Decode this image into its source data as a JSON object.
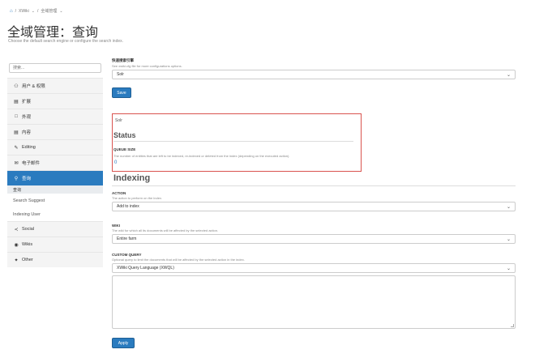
{
  "breadcrumb": {
    "home_icon": "home-icon",
    "items": [
      "XWiki",
      "全域管理"
    ]
  },
  "page": {
    "title": "全域管理：查询",
    "description": "Choose the default search engine or configure the search index."
  },
  "sidebar": {
    "search_placeholder": "搜索...",
    "items": [
      {
        "label": "用户 & 权限",
        "icon": "users-icon"
      },
      {
        "label": "扩展",
        "icon": "extension-icon"
      },
      {
        "label": "外观",
        "icon": "layout-icon"
      },
      {
        "label": "内容",
        "icon": "document-icon"
      },
      {
        "label": "Editing",
        "icon": "pencil-icon"
      },
      {
        "label": "电子邮件",
        "icon": "mail-icon"
      },
      {
        "label": "查询",
        "icon": "search-icon"
      }
    ],
    "active_sub": "查询",
    "sub_links": [
      "Search Suggest",
      "Indexing User"
    ],
    "bottom_items": [
      {
        "label": "Social",
        "icon": "share-icon"
      },
      {
        "label": "Wikis",
        "icon": "globe-icon"
      },
      {
        "label": "Other",
        "icon": "wrench-icon"
      }
    ]
  },
  "engine": {
    "label": "快速搜索引擎",
    "hint": "See xwiki.cfg file for more configurations options.",
    "value": "Solr",
    "save_label": "Save"
  },
  "status": {
    "tab_label": "Solr",
    "heading": "Status",
    "queue_label": "QUEUE SIZE",
    "queue_hint": "The number of entities that are left to be indexed, re-indexed or deleted from the index (depending on the executed action).",
    "queue_value": "0"
  },
  "indexing": {
    "heading": "Indexing",
    "action_label": "ACTION",
    "action_hint": "The action to perform on the index.",
    "action_value": "Add to index",
    "wiki_label": "WIKI",
    "wiki_hint": "The wiki for which all its documents will be affected by the selected action.",
    "wiki_value": "Entire farm",
    "query_label": "CUSTOM QUERY",
    "query_hint": "Optional query to limit the documents that will be affected by the selected action in the index.",
    "query_language": "XWiki Query Language (XWQL)",
    "apply_label": "Apply"
  },
  "colors": {
    "accent": "#2a7bbf",
    "highlight": "#d9534f"
  }
}
